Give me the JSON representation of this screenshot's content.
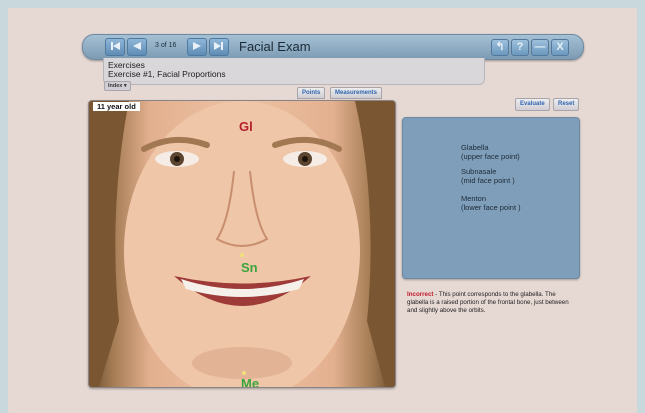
{
  "window": {
    "title": "Facial Exam",
    "counter": "3 of 16",
    "win_buttons": [
      "↰",
      "?",
      "—",
      "X"
    ]
  },
  "breadcrumb": {
    "section": "Exercises",
    "exercise": "Exercise #1, Facial Proportions",
    "index_label": "Index ▾"
  },
  "tabs": [
    "Points",
    "Measurements"
  ],
  "actions": {
    "evaluate": "Evaluate",
    "reset": "Reset"
  },
  "photo": {
    "label": "11 year old",
    "points": {
      "gl": "Gl",
      "sn": "Sn",
      "me": "Me"
    }
  },
  "points_list": [
    {
      "name": "Glabella",
      "desc": "(upper face point)"
    },
    {
      "name": "Subnasale",
      "desc": "(mid face point )"
    },
    {
      "name": "Menton",
      "desc": "(lower face point )"
    }
  ],
  "feedback": {
    "status": "Incorrect",
    "text": " - This point corresponds to the glabella. The glabella is a raised portion of the frontal bone, just between and slightly above the orbits."
  },
  "colors": {
    "accent_blue": "#7f9eba",
    "incorrect_red": "#c0182a",
    "point_green": "#3aa53c",
    "point_red": "#b4202c"
  },
  "icons": [
    "skip-back-icon",
    "prev-icon",
    "next-icon",
    "skip-forward-icon"
  ]
}
